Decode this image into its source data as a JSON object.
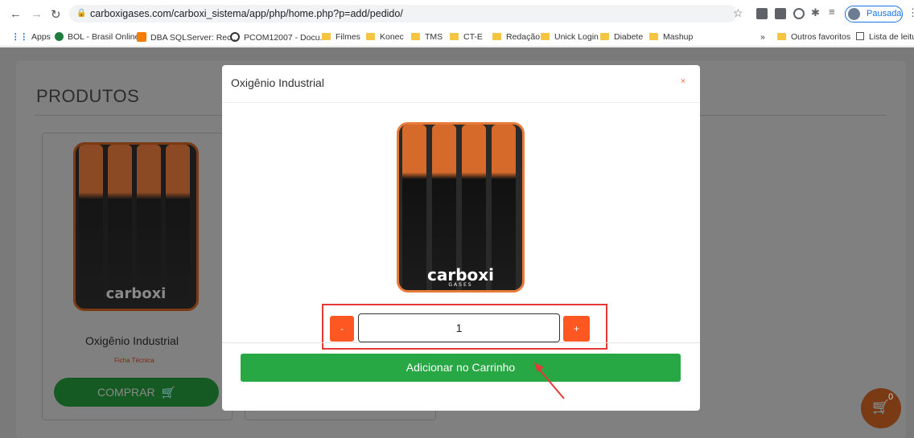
{
  "browser": {
    "url": "carboxigases.com/carboxi_sistema/app/php/home.php?p=add/pedido/",
    "profile_label": "Pausada",
    "bookmarks": [
      {
        "label": "Apps"
      },
      {
        "label": "BOL - Brasil Online"
      },
      {
        "label": "DBA SQLServer: Rec..."
      },
      {
        "label": "PCOM12007 - Docu..."
      },
      {
        "label": "Filmes"
      },
      {
        "label": "Konec"
      },
      {
        "label": "TMS"
      },
      {
        "label": "CT-E"
      },
      {
        "label": "Redação"
      },
      {
        "label": "Unick Login"
      },
      {
        "label": "Diabete"
      },
      {
        "label": "Mashup"
      }
    ],
    "more_label": "»",
    "outros_favoritos": "Outros favoritos",
    "lista_de_leitura": "Lista de leitura"
  },
  "page": {
    "section_title": "PRODUTOS",
    "product": {
      "name": "Oxigênio Industrial",
      "ficha_link": "Ficha Técnica",
      "buy_label": "COMPRAR",
      "image_logo": "carboxi"
    },
    "cart_count": "0"
  },
  "modal": {
    "title": "Oxigênio Industrial",
    "close_label": "×",
    "image_logo": "carboxi",
    "image_logo_sub": "GASES",
    "minus_label": "-",
    "plus_label": "+",
    "quantity": "1",
    "add_to_cart_label": "Adicionar no Carrinho"
  },
  "colors": {
    "accent_orange": "#ff5722",
    "button_green": "#28a745",
    "highlight_red": "#e53935"
  }
}
